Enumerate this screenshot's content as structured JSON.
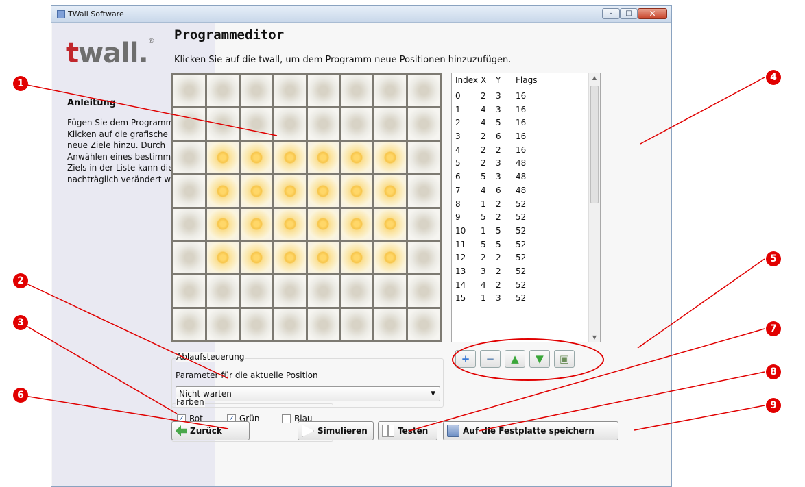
{
  "window": {
    "title": "TWall Software",
    "min": "–",
    "max": "□",
    "close": "✕"
  },
  "logo": {
    "text": "twall.",
    "mark": "®"
  },
  "sidebar": {
    "heading": "Anleitung",
    "text": "Fügen Sie dem Programm durch Klicken auf die grafische twall neue Ziele hinzu. Durch Anwählen eines bestimmten Ziels in der Liste kann dieses nachträglich verändert werden."
  },
  "main": {
    "title": "Programmeditor",
    "subtitle": "Klicken Sie auf die twall, um dem Programm neue Positionen hinzuzufügen."
  },
  "grid": {
    "rows": 8,
    "cols": 8,
    "lit": [
      [
        0,
        0,
        0,
        0,
        0,
        0,
        0,
        0
      ],
      [
        0,
        0,
        0,
        0,
        0,
        0,
        0,
        0
      ],
      [
        0,
        1,
        1,
        1,
        1,
        1,
        1,
        0
      ],
      [
        0,
        1,
        1,
        1,
        1,
        1,
        1,
        0
      ],
      [
        0,
        1,
        1,
        1,
        1,
        1,
        1,
        0
      ],
      [
        0,
        1,
        1,
        1,
        1,
        1,
        1,
        0
      ],
      [
        0,
        0,
        0,
        0,
        0,
        0,
        0,
        0
      ],
      [
        0,
        0,
        0,
        0,
        0,
        0,
        0,
        0
      ]
    ]
  },
  "list": {
    "headers": [
      "Index",
      "X",
      "Y",
      "Flags"
    ],
    "rows": [
      [
        "0",
        "2",
        "3",
        "16"
      ],
      [
        "1",
        "4",
        "3",
        "16"
      ],
      [
        "2",
        "4",
        "5",
        "16"
      ],
      [
        "3",
        "2",
        "6",
        "16"
      ],
      [
        "4",
        "2",
        "2",
        "16"
      ],
      [
        "5",
        "2",
        "3",
        "48"
      ],
      [
        "6",
        "5",
        "3",
        "48"
      ],
      [
        "7",
        "4",
        "6",
        "48"
      ],
      [
        "8",
        "1",
        "2",
        "52"
      ],
      [
        "9",
        "5",
        "2",
        "52"
      ],
      [
        "10",
        "1",
        "5",
        "52"
      ],
      [
        "11",
        "5",
        "5",
        "52"
      ],
      [
        "12",
        "2",
        "2",
        "52"
      ],
      [
        "13",
        "3",
        "2",
        "52"
      ],
      [
        "14",
        "4",
        "2",
        "52"
      ],
      [
        "15",
        "1",
        "3",
        "52"
      ]
    ]
  },
  "tools": {
    "add": "+",
    "remove": "−",
    "up": "▲",
    "down": "▼",
    "delete": "▣"
  },
  "ablauf": {
    "label": "Ablaufsteuerung",
    "param_label": "Parameter für die aktuelle Position",
    "selected": "Nicht warten"
  },
  "farben": {
    "label": "Farben",
    "rot": {
      "label": "Rot",
      "checked": "✓"
    },
    "gruen": {
      "label": "Grün",
      "checked": "✓"
    },
    "blau": {
      "label": "Blau",
      "checked": ""
    }
  },
  "buttons": {
    "back": "Zurück",
    "simulate": "Simulieren",
    "test": "Testen",
    "save": "Auf die Festplatte speichern"
  },
  "callouts": [
    "1",
    "2",
    "3",
    "4",
    "5",
    "6",
    "7",
    "8",
    "9"
  ],
  "colors": {
    "callout": "#e10000",
    "lamp_on": "#f9d26b",
    "grid_frame": "#7d7a72"
  }
}
